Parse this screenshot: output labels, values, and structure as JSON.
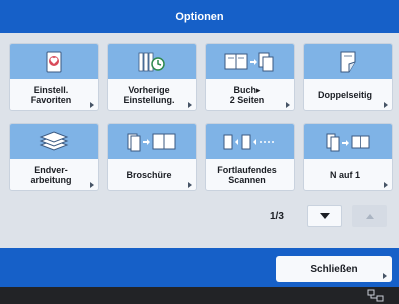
{
  "title": "Optionen",
  "tiles": [
    {
      "label": "Einstell.\nFavoriten",
      "icon": "favorites-heart-icon"
    },
    {
      "label": "Vorherige\nEinstellung.",
      "icon": "previous-settings-icon"
    },
    {
      "label": "Buch▸\n2 Seiten",
      "icon": "book-to-two-pages-icon"
    },
    {
      "label": "Doppelseitig",
      "icon": "duplex-icon"
    },
    {
      "label": "Endver-\narbeitung",
      "icon": "finishing-stack-icon"
    },
    {
      "label": "Broschüre",
      "icon": "booklet-icon"
    },
    {
      "label": "Fortlaufendes\nScannen",
      "icon": "continuous-scan-icon"
    },
    {
      "label": "N auf 1",
      "icon": "n-on-1-icon"
    }
  ],
  "pager": {
    "indicator": "1/3"
  },
  "close_label": "Schließen",
  "colors": {
    "accent": "#1660c8",
    "tile_icon_bg": "#7fb3e6",
    "status_bar": "#222326"
  }
}
